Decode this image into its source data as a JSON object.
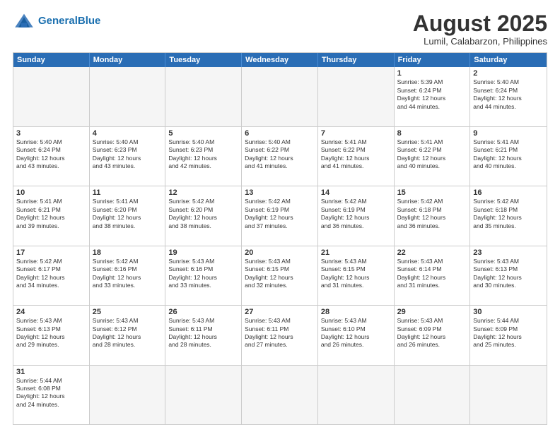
{
  "header": {
    "logo_general": "General",
    "logo_blue": "Blue",
    "month_year": "August 2025",
    "location": "Lumil, Calabarzon, Philippines"
  },
  "weekdays": [
    "Sunday",
    "Monday",
    "Tuesday",
    "Wednesday",
    "Thursday",
    "Friday",
    "Saturday"
  ],
  "rows": [
    [
      {
        "day": "",
        "info": "",
        "empty": true
      },
      {
        "day": "",
        "info": "",
        "empty": true
      },
      {
        "day": "",
        "info": "",
        "empty": true
      },
      {
        "day": "",
        "info": "",
        "empty": true
      },
      {
        "day": "",
        "info": "",
        "empty": true
      },
      {
        "day": "1",
        "info": "Sunrise: 5:39 AM\nSunset: 6:24 PM\nDaylight: 12 hours\nand 44 minutes."
      },
      {
        "day": "2",
        "info": "Sunrise: 5:40 AM\nSunset: 6:24 PM\nDaylight: 12 hours\nand 44 minutes."
      }
    ],
    [
      {
        "day": "3",
        "info": "Sunrise: 5:40 AM\nSunset: 6:24 PM\nDaylight: 12 hours\nand 43 minutes."
      },
      {
        "day": "4",
        "info": "Sunrise: 5:40 AM\nSunset: 6:23 PM\nDaylight: 12 hours\nand 43 minutes."
      },
      {
        "day": "5",
        "info": "Sunrise: 5:40 AM\nSunset: 6:23 PM\nDaylight: 12 hours\nand 42 minutes."
      },
      {
        "day": "6",
        "info": "Sunrise: 5:40 AM\nSunset: 6:22 PM\nDaylight: 12 hours\nand 41 minutes."
      },
      {
        "day": "7",
        "info": "Sunrise: 5:41 AM\nSunset: 6:22 PM\nDaylight: 12 hours\nand 41 minutes."
      },
      {
        "day": "8",
        "info": "Sunrise: 5:41 AM\nSunset: 6:22 PM\nDaylight: 12 hours\nand 40 minutes."
      },
      {
        "day": "9",
        "info": "Sunrise: 5:41 AM\nSunset: 6:21 PM\nDaylight: 12 hours\nand 40 minutes."
      }
    ],
    [
      {
        "day": "10",
        "info": "Sunrise: 5:41 AM\nSunset: 6:21 PM\nDaylight: 12 hours\nand 39 minutes."
      },
      {
        "day": "11",
        "info": "Sunrise: 5:41 AM\nSunset: 6:20 PM\nDaylight: 12 hours\nand 38 minutes."
      },
      {
        "day": "12",
        "info": "Sunrise: 5:42 AM\nSunset: 6:20 PM\nDaylight: 12 hours\nand 38 minutes."
      },
      {
        "day": "13",
        "info": "Sunrise: 5:42 AM\nSunset: 6:19 PM\nDaylight: 12 hours\nand 37 minutes."
      },
      {
        "day": "14",
        "info": "Sunrise: 5:42 AM\nSunset: 6:19 PM\nDaylight: 12 hours\nand 36 minutes."
      },
      {
        "day": "15",
        "info": "Sunrise: 5:42 AM\nSunset: 6:18 PM\nDaylight: 12 hours\nand 36 minutes."
      },
      {
        "day": "16",
        "info": "Sunrise: 5:42 AM\nSunset: 6:18 PM\nDaylight: 12 hours\nand 35 minutes."
      }
    ],
    [
      {
        "day": "17",
        "info": "Sunrise: 5:42 AM\nSunset: 6:17 PM\nDaylight: 12 hours\nand 34 minutes."
      },
      {
        "day": "18",
        "info": "Sunrise: 5:42 AM\nSunset: 6:16 PM\nDaylight: 12 hours\nand 33 minutes."
      },
      {
        "day": "19",
        "info": "Sunrise: 5:43 AM\nSunset: 6:16 PM\nDaylight: 12 hours\nand 33 minutes."
      },
      {
        "day": "20",
        "info": "Sunrise: 5:43 AM\nSunset: 6:15 PM\nDaylight: 12 hours\nand 32 minutes."
      },
      {
        "day": "21",
        "info": "Sunrise: 5:43 AM\nSunset: 6:15 PM\nDaylight: 12 hours\nand 31 minutes."
      },
      {
        "day": "22",
        "info": "Sunrise: 5:43 AM\nSunset: 6:14 PM\nDaylight: 12 hours\nand 31 minutes."
      },
      {
        "day": "23",
        "info": "Sunrise: 5:43 AM\nSunset: 6:13 PM\nDaylight: 12 hours\nand 30 minutes."
      }
    ],
    [
      {
        "day": "24",
        "info": "Sunrise: 5:43 AM\nSunset: 6:13 PM\nDaylight: 12 hours\nand 29 minutes."
      },
      {
        "day": "25",
        "info": "Sunrise: 5:43 AM\nSunset: 6:12 PM\nDaylight: 12 hours\nand 28 minutes."
      },
      {
        "day": "26",
        "info": "Sunrise: 5:43 AM\nSunset: 6:11 PM\nDaylight: 12 hours\nand 28 minutes."
      },
      {
        "day": "27",
        "info": "Sunrise: 5:43 AM\nSunset: 6:11 PM\nDaylight: 12 hours\nand 27 minutes."
      },
      {
        "day": "28",
        "info": "Sunrise: 5:43 AM\nSunset: 6:10 PM\nDaylight: 12 hours\nand 26 minutes."
      },
      {
        "day": "29",
        "info": "Sunrise: 5:43 AM\nSunset: 6:09 PM\nDaylight: 12 hours\nand 26 minutes."
      },
      {
        "day": "30",
        "info": "Sunrise: 5:44 AM\nSunset: 6:09 PM\nDaylight: 12 hours\nand 25 minutes."
      }
    ],
    [
      {
        "day": "31",
        "info": "Sunrise: 5:44 AM\nSunset: 6:08 PM\nDaylight: 12 hours\nand 24 minutes."
      },
      {
        "day": "",
        "info": "",
        "empty": true
      },
      {
        "day": "",
        "info": "",
        "empty": true
      },
      {
        "day": "",
        "info": "",
        "empty": true
      },
      {
        "day": "",
        "info": "",
        "empty": true
      },
      {
        "day": "",
        "info": "",
        "empty": true
      },
      {
        "day": "",
        "info": "",
        "empty": true
      }
    ]
  ]
}
